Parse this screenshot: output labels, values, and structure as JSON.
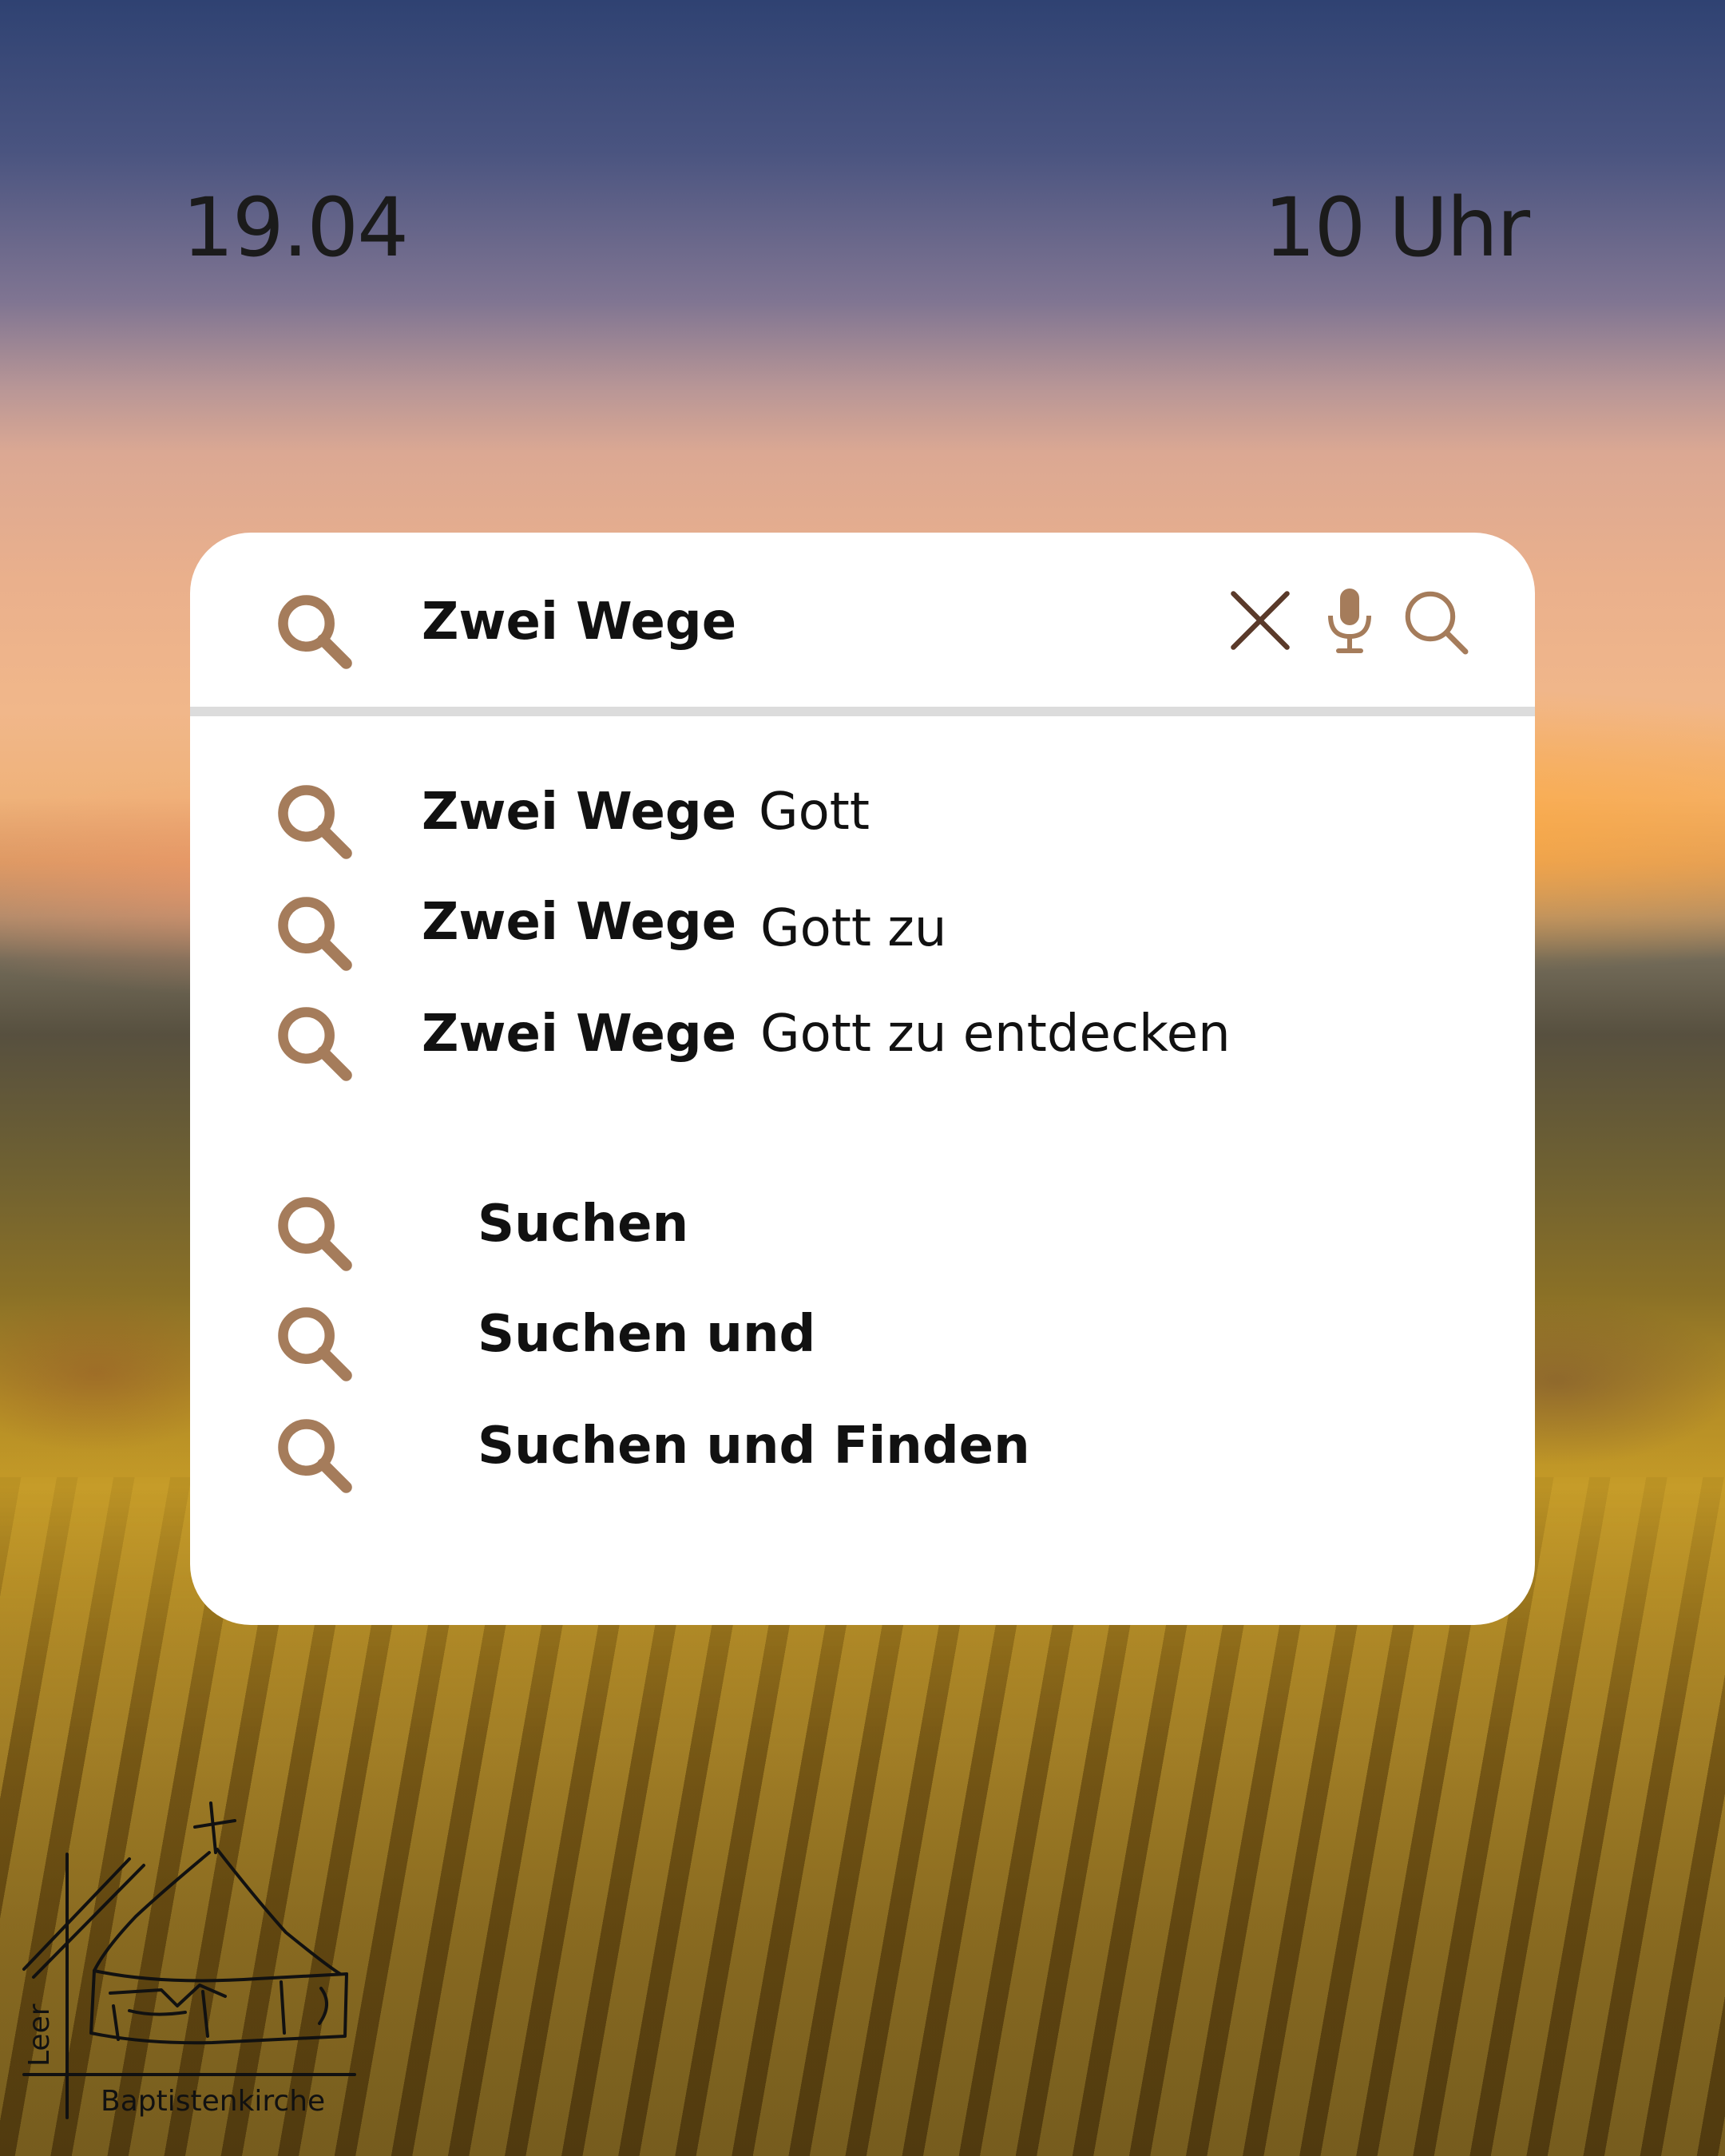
{
  "event": {
    "date": "19.04",
    "time": "10 Uhr"
  },
  "search": {
    "query": "Zwei Wege",
    "clear_icon": "close-icon",
    "voice_icon": "microphone-icon",
    "submit_icon": "search-icon"
  },
  "suggestions": [
    {
      "bold": "Zwei Wege",
      "rest": "Gott"
    },
    {
      "bold": "Zwei Wege",
      "rest": "Gott zu"
    },
    {
      "bold": "Zwei Wege",
      "rest": "Gott zu entdecken"
    }
  ],
  "more_suggestions": [
    {
      "label": "Suchen"
    },
    {
      "label": "Suchen und"
    },
    {
      "label": "Suchen und Finden"
    }
  ],
  "logo": {
    "name": "Baptistenkirche",
    "town": "Leer"
  },
  "colors": {
    "icon_brown": "#a57c5b",
    "text": "#111111",
    "card": "#ffffff"
  }
}
